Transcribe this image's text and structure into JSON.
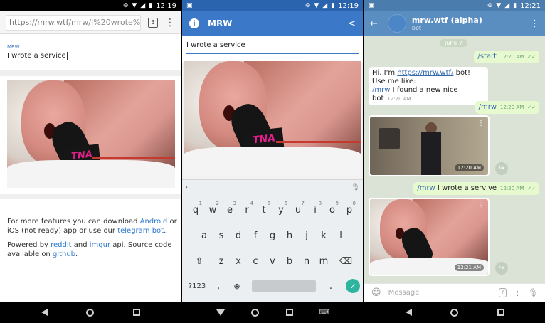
{
  "panel1": {
    "status_time": "12:19",
    "url": "https://mrw.wtf/mrw/I%20wrote%20",
    "url_host": "https://mrw.wtf",
    "url_path": "/mrw/I%20wrote%2",
    "tab_count": "3",
    "field_label": "MRW",
    "field_value": "I wrote a service",
    "info_1a": "For more features you can download ",
    "link_android": "Android",
    "info_1b": " or iOS (not ready) app or use our ",
    "link_telegram": "telegram bot",
    "info_1c": ".",
    "info_2a": "Powered by ",
    "link_reddit": "reddit",
    "info_2b": " and ",
    "link_imgur": "imgur",
    "info_2c": " api. Source code available on ",
    "link_github": "github",
    "info_2d": "."
  },
  "panel2": {
    "status_time": "12:19",
    "app_title": "MRW",
    "field_value": "I wrote a service",
    "keyboard": {
      "row1": [
        "q",
        "w",
        "e",
        "r",
        "t",
        "y",
        "u",
        "i",
        "o",
        "p"
      ],
      "row1_nums": [
        "1",
        "2",
        "3",
        "4",
        "5",
        "6",
        "7",
        "8",
        "9",
        "0"
      ],
      "row2": [
        "a",
        "s",
        "d",
        "f",
        "g",
        "h",
        "j",
        "k",
        "l"
      ],
      "row3": [
        "z",
        "x",
        "c",
        "v",
        "b",
        "n",
        "m"
      ],
      "symbols_key": "?123",
      "comma": ",",
      "period": "."
    }
  },
  "panel3": {
    "status_time": "12:21",
    "chat_name": "mrw.wtf (alpha)",
    "chat_sub": "bot",
    "date": "June 7",
    "msg_start": "/start",
    "msg_start_time": "12:20 AM",
    "bot_line1a": "Hi, I'm ",
    "bot_link": "https://mrw.wtf/",
    "bot_line1b": " bot!",
    "bot_line2": "Use me like:",
    "bot_cmd": "/mrw",
    "bot_line3": " I found a new nice bot",
    "bot_time": "12:20 AM",
    "msg_mrw": "/mrw",
    "msg_mrw_time": "12:20 AM",
    "media1_time": "12:20 AM",
    "msg2_cmd": "/mrw",
    "msg2_text": " I wrote a servive",
    "msg2_time": "12:20 AM",
    "media2_time": "12:21 AM",
    "input_placeholder": "Message"
  },
  "icons": [
    "wifi-icon",
    "signal-icon",
    "battery-icon",
    "back-icon",
    "home-icon",
    "recents-icon",
    "info-icon",
    "share-icon",
    "menu-icon",
    "mic-icon",
    "emoji-icon",
    "attach-icon",
    "command-icon",
    "shift-icon",
    "backspace-icon",
    "done-icon",
    "forward-icon",
    "keyboard-hide-icon"
  ]
}
